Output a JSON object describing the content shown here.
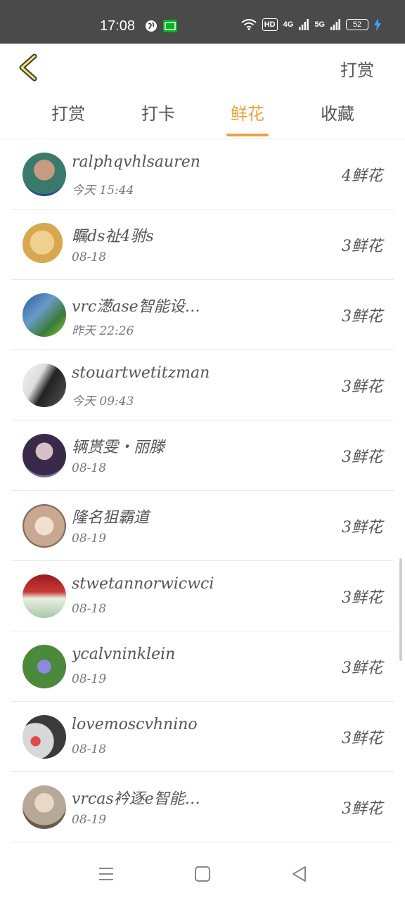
{
  "status": {
    "time": "17:08",
    "hd": "HD",
    "net1": "4G",
    "net2": "5G",
    "battery": "52"
  },
  "header": {
    "action": "打赏"
  },
  "tabs": [
    {
      "label": "打赏"
    },
    {
      "label": "打卡"
    },
    {
      "label": "鲜花"
    },
    {
      "label": "收藏"
    }
  ],
  "list": [
    {
      "name": "ralphqvhlsauren",
      "time": "今天 15:44",
      "count": "4鲜花",
      "color": "#3a7a6a"
    },
    {
      "name": "瞩ds祉4驸s",
      "time": "08-18",
      "count": "3鲜花",
      "color": "#e0b860"
    },
    {
      "name": "vrc濍ase智能设…",
      "time": "昨天 22:26",
      "count": "3鲜花",
      "color": "#3a6a9a"
    },
    {
      "name": "stouartwetitzman",
      "time": "今天 09:43",
      "count": "3鲜花",
      "color": "#444444"
    },
    {
      "name": "辆贳雯・丽滕",
      "time": "08-18",
      "count": "3鲜花",
      "color": "#5a4a7a"
    },
    {
      "name": "隆名狙霸道",
      "time": "08-19",
      "count": "3鲜花",
      "color": "#c8a890"
    },
    {
      "name": "stwetannorwicwci",
      "time": "08-18",
      "count": "3鲜花",
      "color": "#9a2a2a"
    },
    {
      "name": "ycalvninklein",
      "time": "08-19",
      "count": "3鲜花",
      "color": "#5a8a4a"
    },
    {
      "name": "lovemoscvhnino",
      "time": "08-18",
      "count": "3鲜花",
      "color": "#666666"
    },
    {
      "name": "vrcas衿逐e智能…",
      "time": "08-19",
      "count": "3鲜花",
      "color": "#9a8a7a"
    }
  ]
}
